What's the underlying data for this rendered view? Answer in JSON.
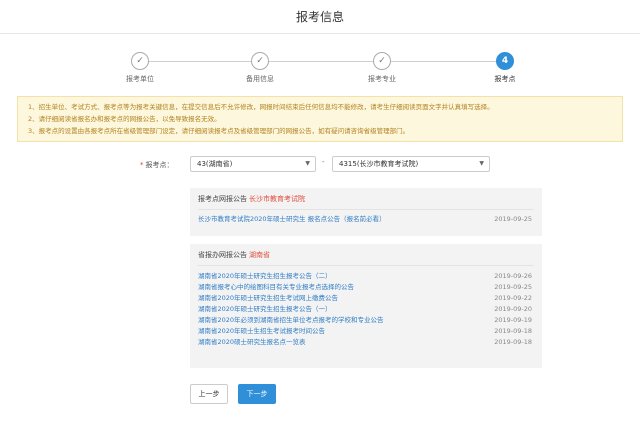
{
  "header": {
    "title": "报考信息"
  },
  "steps": [
    {
      "num": "✓",
      "label": "报考单位"
    },
    {
      "num": "✓",
      "label": "备用信息"
    },
    {
      "num": "✓",
      "label": "报考专业"
    },
    {
      "num": "4",
      "label": "报考点"
    }
  ],
  "notice": {
    "lines": [
      "1、招生单位、考试方式、报考点等为报考关键信息，在提交信息后不允许修改，网报时间结束后任何信息均不能修改，请考生仔细阅读页面文字并认真填写选择。",
      "2、请仔细阅读省报名办和报考点的网报公告，以免导致报名无效。",
      "3、报考点的设置由各报考点所在省级管理部门设定，请仔细阅读报考点及省级管理部门的网报公告，如有疑问请咨询省级管理部门。"
    ]
  },
  "form": {
    "label": "报考点：",
    "required_mark": "*",
    "province_value": "43(湖南省)",
    "separator": "-",
    "site_value": "4315(长沙市教育考试院)"
  },
  "site_panel": {
    "title": "报考点网报公告",
    "subtitle": "长沙市教育考试院",
    "items": [
      {
        "text": "长沙市教育考试院2020年硕士研究生 报名点公告（报名前必看）",
        "date": "2019-09-25"
      }
    ]
  },
  "prov_panel": {
    "title": "省报办网报公告",
    "subtitle": "湖南省",
    "items": [
      {
        "text": "湖南省2020年硕士研究生招生报考公告（二）",
        "date": "2019-09-26"
      },
      {
        "text": "湖南省报考心中的绘图科目有关专业报考点选择的公告",
        "date": "2019-09-25"
      },
      {
        "text": "湖南省2020年硕士研究生招生考试网上缴费公告",
        "date": "2019-09-22"
      },
      {
        "text": "湖南省2020年硕士研究生招生报考公告（一）",
        "date": "2019-09-20"
      },
      {
        "text": "湖南省2020年必须到湖南省招生单位考点报考的学校和专业公告",
        "date": "2019-09-19"
      },
      {
        "text": "湖南省2020年硕士生招生考试报考时间公告",
        "date": "2019-09-18"
      },
      {
        "text": "湖南省2020硕士研究生报名点一览表",
        "date": "2019-09-18"
      }
    ]
  },
  "buttons": {
    "prev": "上一步",
    "next": "下一步"
  },
  "colors": {
    "accent": "#2f8fd8",
    "link": "#2f7dc4",
    "notice_bg": "#fdf7dd",
    "notice_text": "#b2821e",
    "alert": "#e04c3a"
  }
}
